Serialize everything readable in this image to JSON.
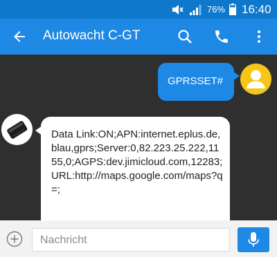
{
  "status_bar": {
    "battery_percent": "76%",
    "time": "16:40",
    "icons": [
      "mute-icon",
      "signal-icon",
      "battery-icon"
    ]
  },
  "app_bar": {
    "title": "Autowacht C-GT",
    "icons": [
      "back-arrow-icon",
      "search-icon",
      "phone-icon",
      "more-vert-icon"
    ]
  },
  "messages": [
    {
      "direction": "outgoing",
      "text": "GPRSSET#",
      "avatar": "user-avatar-icon"
    },
    {
      "direction": "incoming",
      "text": "Data Link:ON;APN:internet.eplus.de,blau,gprs;Server:0,82.223.25.222,1155,0;AGPS:dev.jimicloud.com,12283;URL:http://maps.google.com/maps?q=;",
      "avatar": "gps-tracker-icon"
    }
  ],
  "composer": {
    "placeholder": "Nachricht",
    "icons": [
      "add-circle-icon",
      "mic-icon"
    ]
  },
  "colors": {
    "status_bar": "#0d78cc",
    "app_bar": "#1e88e5",
    "chat_background": "#2f2f2f",
    "outgoing_bubble": "#1e88e5",
    "incoming_bubble": "#ffffff",
    "user_avatar": "#f5c518"
  }
}
